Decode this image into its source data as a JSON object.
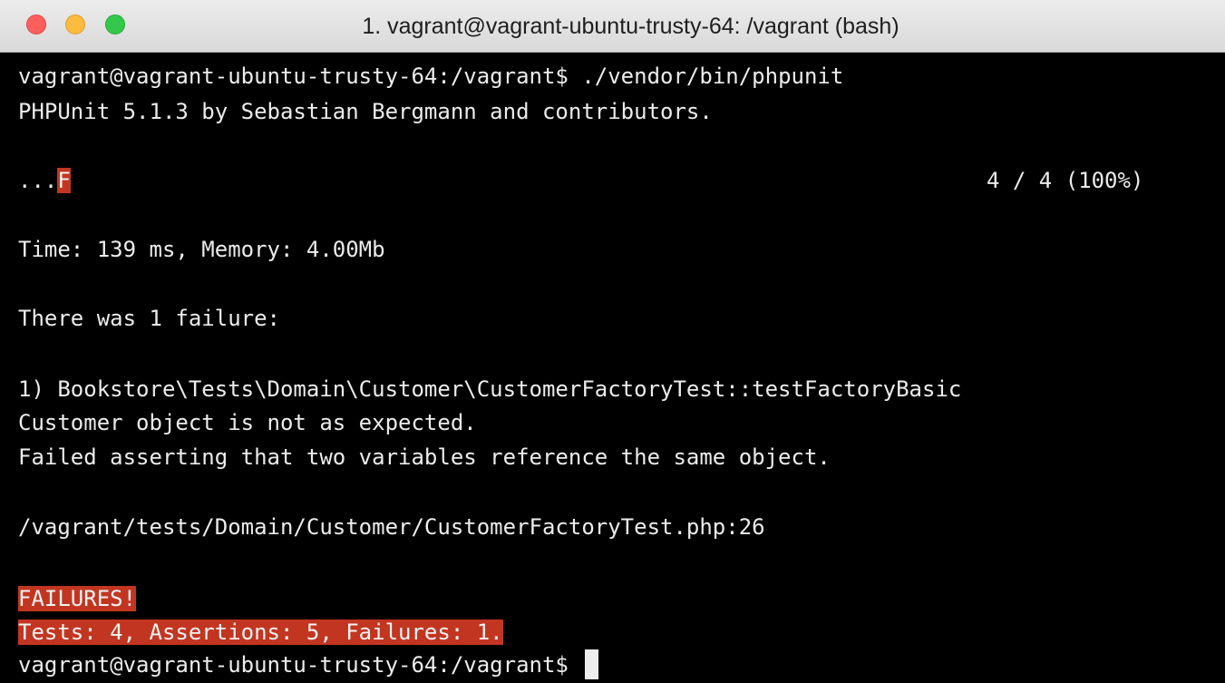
{
  "window": {
    "title": "1. vagrant@vagrant-ubuntu-trusty-64: /vagrant (bash)"
  },
  "colors": {
    "failure_highlight": "#c23621",
    "terminal_bg": "#000000",
    "terminal_fg": "#ececec"
  },
  "terminal": {
    "prompt": "vagrant@vagrant-ubuntu-trusty-64:/vagrant$",
    "command": " ./vendor/bin/phpunit",
    "version_line": "PHPUnit 5.1.3 by Sebastian Bergmann and contributors.",
    "progress_dots": "...",
    "progress_fail": "F",
    "progress_count": "4 / 4 (100%)",
    "time_line": "Time: 139 ms, Memory: 4.00Mb",
    "failure_header": "There was 1 failure:",
    "failure_test": "1) Bookstore\\Tests\\Domain\\Customer\\CustomerFactoryTest::testFactoryBasic",
    "failure_message": "Customer object is not as expected.",
    "failure_detail": "Failed asserting that two variables reference the same object.",
    "failure_location": "/vagrant/tests/Domain/Customer/CustomerFactoryTest.php:26",
    "failures_banner": "FAILURES!",
    "summary": "Tests: 4, Assertions: 5, Failures: 1.",
    "final_prompt": "vagrant@vagrant-ubuntu-trusty-64:/vagrant$ "
  }
}
